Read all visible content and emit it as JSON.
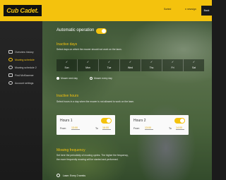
{
  "app": {
    "logo_text": "Cub Cadet."
  },
  "header": {
    "user_link": "Sorted",
    "lang_link": "n newsign",
    "back_label": "Back"
  },
  "sidebar": {
    "items": [
      {
        "label": "Overview history",
        "active": false
      },
      {
        "label": "Mowing schedule",
        "active": true
      },
      {
        "label": "Mowing schedule 2",
        "active": false
      },
      {
        "label": "Find McKlawmer",
        "active": false
      },
      {
        "label": "Account settings",
        "active": false
      }
    ]
  },
  "auto": {
    "label": "Automatic operation",
    "enabled": true
  },
  "active_days": {
    "title": "Inactive days",
    "desc": "Select days on which the mower should not work on the lawn.",
    "days": [
      {
        "label": "Sun",
        "checked": true
      },
      {
        "label": "Mon",
        "checked": true
      },
      {
        "label": "Tue",
        "checked": true
      },
      {
        "label": "Wed",
        "checked": true
      },
      {
        "label": "Thu",
        "checked": true
      },
      {
        "label": "Fri",
        "checked": true
      },
      {
        "label": "Sat",
        "checked": true
      }
    ],
    "option_a": "Mower next day",
    "option_b": "Mower every day"
  },
  "inactive_hours": {
    "title": "Inactive hours",
    "desc": "Select hours in a day when the mower is not allowed to work on the lawn."
  },
  "hours1": {
    "title": "Hours 1",
    "from_label": "From",
    "from_value": "13:00",
    "to_label": "To",
    "to_value": "16:00",
    "enabled": true
  },
  "hours2": {
    "title": "Hours 2",
    "from_label": "From",
    "from_value": "13:00",
    "to_label": "To",
    "to_value": "14:00",
    "enabled": true
  },
  "mowing_frequency": {
    "title": "Mowing frequency",
    "desc_line1": "Set here the periodicity of mowing cycles. The higher the frequency,",
    "desc_line2": "the more frequently mowing will be started and performed.",
    "mow_label": "Lawn: Every 2 weeks"
  },
  "colors": {
    "accent": "#f4c20d",
    "sidebar": "#1f1f1f"
  }
}
